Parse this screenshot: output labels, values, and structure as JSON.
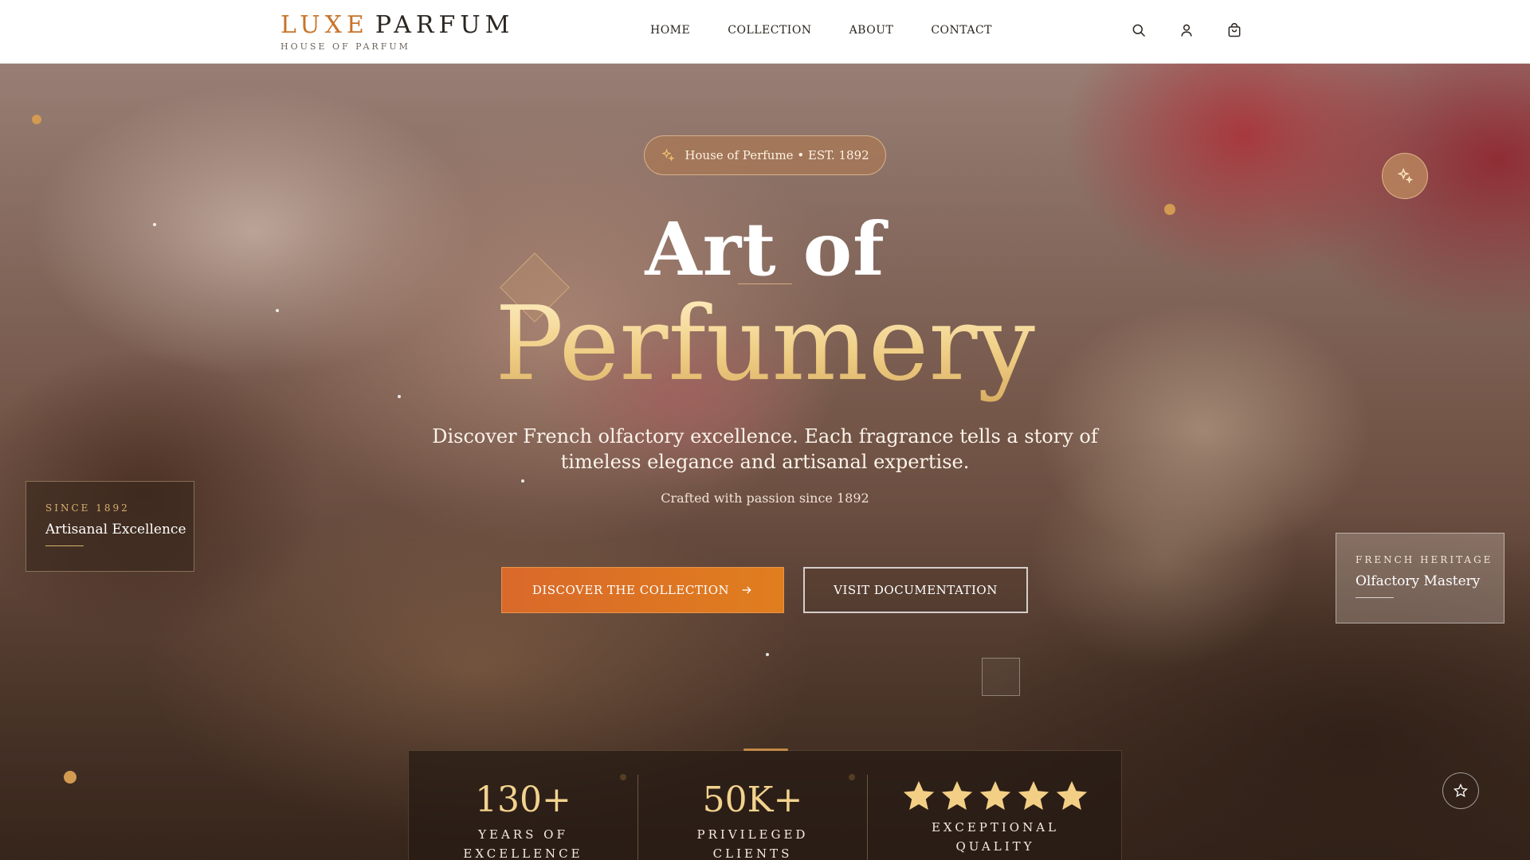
{
  "brand": {
    "name_part1": "LUXE",
    "name_part2": "PARFUM",
    "subtitle": "HOUSE OF PARFUM",
    "accent_color": "#c9742a"
  },
  "nav": {
    "items": [
      {
        "label": "HOME"
      },
      {
        "label": "COLLECTION"
      },
      {
        "label": "ABOUT"
      },
      {
        "label": "CONTACT"
      }
    ]
  },
  "header_icons": [
    "search-icon",
    "user-icon",
    "shopping-bag-icon"
  ],
  "hero": {
    "badge": "House of Perfume • EST. 1892",
    "title_line1": "Art of",
    "title_line2": "Perfumery",
    "subtitle": "Discover French olfactory excellence. Each fragrance tells a story of timeless elegance and artisanal expertise.",
    "tagline": "Crafted with passion since 1892",
    "primary_button": "DISCOVER THE COLLECTION",
    "secondary_button": "VISIT DOCUMENTATION"
  },
  "cards": {
    "left": {
      "kicker": "SINCE 1892",
      "label": "Artisanal Excellence"
    },
    "right": {
      "kicker": "FRENCH HERITAGE",
      "label": "Olfactory Mastery"
    }
  },
  "stats": [
    {
      "value": "130+",
      "caption": "YEARS OF\nEXCELLENCE"
    },
    {
      "value": "50K+",
      "caption": "PRIVILEGED\nCLIENTS"
    },
    {
      "rating": 5,
      "caption": "EXCEPTIONAL\nQUALITY"
    }
  ],
  "colors": {
    "cta_orange": "#e07e1e",
    "gold": "#f2d28e"
  }
}
